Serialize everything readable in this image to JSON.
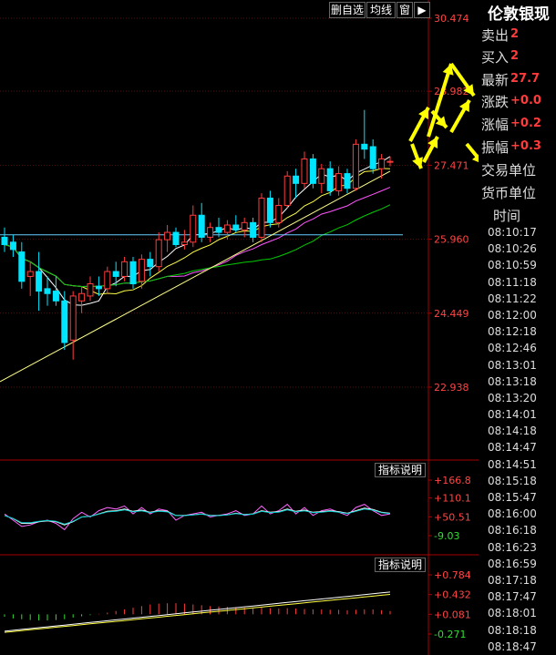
{
  "toolbar": {
    "delete_watch": "删自选",
    "ma_line": "均线",
    "window": "窗",
    "arrow_glyph": "▶"
  },
  "panel": {
    "title": "伦敦银现",
    "rows": [
      {
        "label": "卖出",
        "value": "2"
      },
      {
        "label": "买入",
        "value": "2"
      },
      {
        "label": "最新",
        "value": "27.7"
      },
      {
        "label": "涨跌",
        "value": "+0.0"
      },
      {
        "label": "涨幅",
        "value": "+0.2"
      },
      {
        "label": "振幅",
        "value": "+0.3"
      },
      {
        "label": "交易单位",
        "value": ""
      },
      {
        "label": "货币单位",
        "value": ""
      }
    ],
    "time_header": "时间",
    "times": [
      "08:10:17",
      "08:10:26",
      "08:10:59",
      "08:11:18",
      "08:11:22",
      "08:12:00",
      "08:12:18",
      "08:12:46",
      "08:13:01",
      "08:13:18",
      "08:13:20",
      "08:14:01",
      "08:14:18",
      "08:14:47",
      "08:14:51",
      "08:15:18",
      "08:15:47",
      "08:16:00",
      "08:16:18",
      "08:16:23",
      "08:16:59",
      "08:17:18",
      "08:17:47",
      "08:18:01",
      "08:18:18",
      "08:18:47"
    ]
  },
  "indicators": {
    "label1": "指标说明",
    "label2": "指标说明"
  },
  "colors": {
    "up": "#ff3b3b",
    "down": "#00e5ff",
    "ma5": "#ffffff",
    "ma10": "#ffff44",
    "ma20": "#ff55ff",
    "ma30": "#00cc00",
    "ma60": "#66ccff",
    "trend": "#ffff88",
    "axis": "#aa0000",
    "arrow": "#ffff00"
  },
  "chart_data": [
    {
      "type": "candlestick",
      "y_ticks": [
        "30.474",
        "28.982",
        "27.471",
        "25.960",
        "24.449",
        "22.938"
      ],
      "ylim": [
        22.2,
        30.474
      ],
      "candles": [
        {
          "o": 26.0,
          "h": 26.2,
          "l": 25.7,
          "c": 25.85
        },
        {
          "o": 25.9,
          "h": 26.05,
          "l": 25.6,
          "c": 25.75
        },
        {
          "o": 25.7,
          "h": 25.9,
          "l": 24.95,
          "c": 25.1
        },
        {
          "o": 25.2,
          "h": 25.5,
          "l": 24.8,
          "c": 25.3
        },
        {
          "o": 25.3,
          "h": 25.7,
          "l": 24.5,
          "c": 24.9
        },
        {
          "o": 24.95,
          "h": 25.2,
          "l": 24.6,
          "c": 24.85
        },
        {
          "o": 24.9,
          "h": 25.2,
          "l": 24.6,
          "c": 24.7
        },
        {
          "o": 24.7,
          "h": 24.9,
          "l": 23.7,
          "c": 23.85
        },
        {
          "o": 23.9,
          "h": 24.9,
          "l": 23.5,
          "c": 24.8
        },
        {
          "o": 24.7,
          "h": 25.0,
          "l": 24.45,
          "c": 24.85
        },
        {
          "o": 24.8,
          "h": 25.2,
          "l": 24.7,
          "c": 25.05
        },
        {
          "o": 25.0,
          "h": 25.2,
          "l": 24.8,
          "c": 24.95
        },
        {
          "o": 24.95,
          "h": 25.4,
          "l": 24.85,
          "c": 25.3
        },
        {
          "o": 25.3,
          "h": 25.5,
          "l": 25.0,
          "c": 25.2
        },
        {
          "o": 25.2,
          "h": 25.6,
          "l": 25.1,
          "c": 25.5
        },
        {
          "o": 25.5,
          "h": 25.6,
          "l": 24.95,
          "c": 25.05
        },
        {
          "o": 25.1,
          "h": 25.65,
          "l": 24.95,
          "c": 25.55
        },
        {
          "o": 25.55,
          "h": 25.7,
          "l": 25.2,
          "c": 25.4
        },
        {
          "o": 25.4,
          "h": 26.1,
          "l": 25.3,
          "c": 25.95
        },
        {
          "o": 25.95,
          "h": 26.25,
          "l": 25.7,
          "c": 26.1
        },
        {
          "o": 26.1,
          "h": 26.2,
          "l": 25.8,
          "c": 25.85
        },
        {
          "o": 25.85,
          "h": 26.15,
          "l": 25.75,
          "c": 25.9
        },
        {
          "o": 25.9,
          "h": 26.65,
          "l": 25.8,
          "c": 26.45
        },
        {
          "o": 26.45,
          "h": 26.7,
          "l": 25.9,
          "c": 26.0
        },
        {
          "o": 26.0,
          "h": 26.3,
          "l": 25.9,
          "c": 26.2
        },
        {
          "o": 26.2,
          "h": 26.4,
          "l": 26.0,
          "c": 26.1
        },
        {
          "o": 26.1,
          "h": 26.35,
          "l": 25.95,
          "c": 26.25
        },
        {
          "o": 26.25,
          "h": 26.45,
          "l": 26.1,
          "c": 26.15
        },
        {
          "o": 26.15,
          "h": 26.4,
          "l": 26.0,
          "c": 26.3
        },
        {
          "o": 26.3,
          "h": 26.4,
          "l": 25.9,
          "c": 26.0
        },
        {
          "o": 26.0,
          "h": 26.9,
          "l": 25.9,
          "c": 26.8
        },
        {
          "o": 26.8,
          "h": 26.95,
          "l": 26.2,
          "c": 26.3
        },
        {
          "o": 26.3,
          "h": 26.8,
          "l": 26.2,
          "c": 26.65
        },
        {
          "o": 26.65,
          "h": 27.35,
          "l": 26.6,
          "c": 27.25
        },
        {
          "o": 27.25,
          "h": 27.4,
          "l": 26.8,
          "c": 27.1
        },
        {
          "o": 27.1,
          "h": 27.75,
          "l": 27.0,
          "c": 27.6
        },
        {
          "o": 27.6,
          "h": 27.7,
          "l": 27.0,
          "c": 27.1
        },
        {
          "o": 27.1,
          "h": 27.5,
          "l": 26.9,
          "c": 27.4
        },
        {
          "o": 27.4,
          "h": 27.55,
          "l": 26.85,
          "c": 26.95
        },
        {
          "o": 26.95,
          "h": 27.45,
          "l": 26.85,
          "c": 27.3
        },
        {
          "o": 27.3,
          "h": 27.4,
          "l": 26.9,
          "c": 27.0
        },
        {
          "o": 27.0,
          "h": 28.0,
          "l": 26.95,
          "c": 27.9
        },
        {
          "o": 27.9,
          "h": 28.6,
          "l": 27.6,
          "c": 27.8
        },
        {
          "o": 27.85,
          "h": 28.0,
          "l": 27.3,
          "c": 27.4
        },
        {
          "o": 27.4,
          "h": 27.7,
          "l": 27.2,
          "c": 27.6
        },
        {
          "o": 27.55,
          "h": 27.65,
          "l": 27.45,
          "c": 27.55
        }
      ]
    },
    {
      "type": "line",
      "y_ticks": [
        "+166.8",
        "+110.1",
        "+50.51",
        "-9.03"
      ],
      "ylim": [
        -40,
        170
      ],
      "series": [
        {
          "values": [
            60,
            40,
            20,
            25,
            35,
            40,
            30,
            10,
            45,
            65,
            50,
            70,
            80,
            75,
            85,
            60,
            80,
            60,
            75,
            70,
            40,
            55,
            60,
            65,
            50,
            55,
            60,
            70,
            55,
            60,
            85,
            60,
            70,
            90,
            60,
            80,
            55,
            70,
            75,
            65,
            55,
            80,
            90,
            70,
            55,
            60
          ]
        },
        {
          "values": [
            55,
            45,
            30,
            30,
            35,
            38,
            35,
            25,
            35,
            50,
            52,
            60,
            68,
            70,
            75,
            68,
            72,
            65,
            70,
            68,
            55,
            55,
            57,
            60,
            55,
            55,
            57,
            62,
            58,
            60,
            70,
            65,
            67,
            75,
            68,
            72,
            65,
            67,
            70,
            67,
            62,
            70,
            78,
            74,
            65,
            62
          ]
        }
      ]
    },
    {
      "type": "bar",
      "y_ticks": [
        "+0.784",
        "+0.432",
        "+0.081",
        "-0.271"
      ],
      "ylim": [
        -0.45,
        0.8
      ],
      "values": [
        -0.06,
        -0.1,
        -0.12,
        -0.14,
        -0.15,
        -0.15,
        -0.14,
        -0.12,
        -0.08,
        -0.05,
        -0.02,
        0.01,
        0.04,
        0.08,
        0.12,
        0.16,
        0.2,
        0.24,
        0.26,
        0.27,
        0.27,
        0.26,
        0.24,
        0.22,
        0.2,
        0.19,
        0.18,
        0.17,
        0.16,
        0.15,
        0.16,
        0.15,
        0.14,
        0.15,
        0.14,
        0.13,
        0.12,
        0.12,
        0.11,
        0.11,
        0.1,
        0.11,
        0.12,
        0.12,
        0.1,
        0.08
      ]
    }
  ]
}
